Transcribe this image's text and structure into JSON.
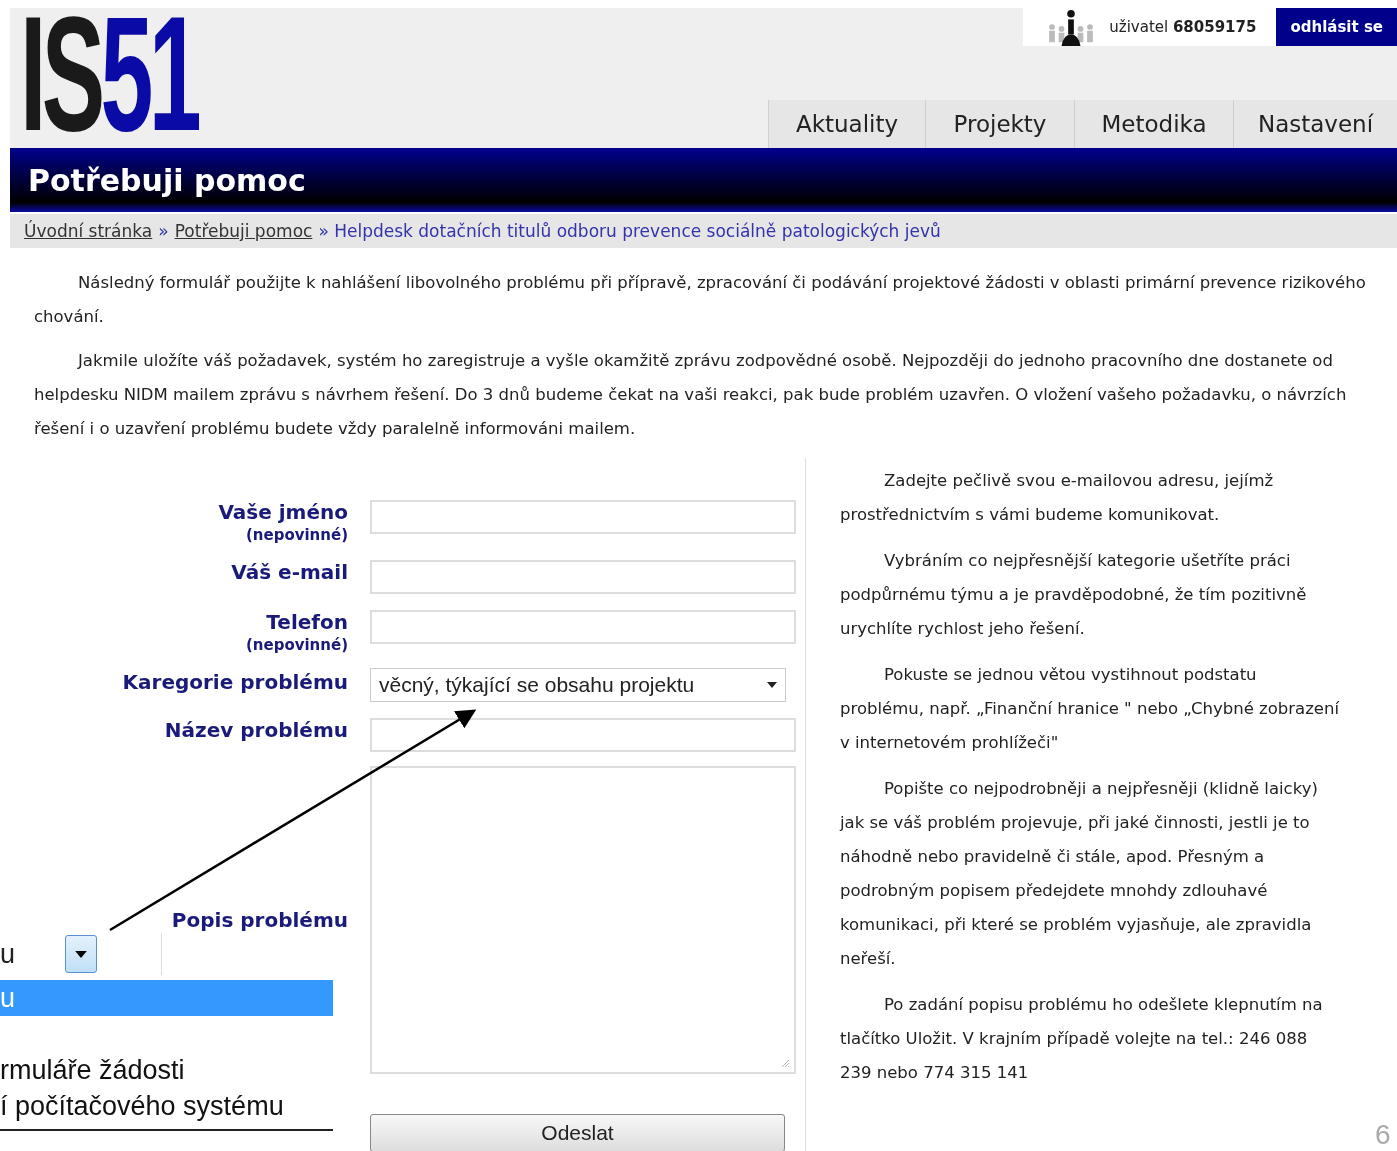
{
  "logo": {
    "part_1": "IS",
    "part_2": "51"
  },
  "user": {
    "label": "uživatel",
    "id": "68059175",
    "logout": "odhlásit se"
  },
  "tabs": [
    {
      "label": "Aktuality",
      "selected": false
    },
    {
      "label": "Projekty",
      "selected": false
    },
    {
      "label": "Metodika",
      "selected": false
    },
    {
      "label": "Nastavení",
      "selected": false
    }
  ],
  "page_title": "Potřebuji pomoc",
  "breadcrumb": [
    {
      "label": "Úvodní stránka",
      "link": true
    },
    {
      "label": "»",
      "link": false
    },
    {
      "label": "Potřebuji pomoc",
      "link": true
    },
    {
      "label": "» Helpdesk dotačních titulů odboru prevence sociálně patologických jevů",
      "link": false
    }
  ],
  "intro": [
    "Následný formulář použijte k nahlášení libovolného problému při přípravě, zpracování či podávání projektové žádosti v oblasti primární prevence rizikového chování.",
    "Jakmile uložíte váš požadavek, systém ho zaregistruje a vyšle okamžitě zprávu zodpovědné osobě. Nejpozději do jednoho pracovního dne dostanete od helpdesku NIDM mailem zprávu s návrhem řešení. Do 3 dnů budeme čekat na vaši reakci, pak bude problém uzavřen. O vložení vašeho požadavku, o návrzích řešení i o uzavření problému budete vždy paralelně informováni mailem."
  ],
  "form": {
    "fields": [
      {
        "kind": "text",
        "label": "Vaše jméno",
        "note": "(nepovinné)"
      },
      {
        "kind": "text",
        "label": "Váš e-mail"
      },
      {
        "kind": "text",
        "label": "Telefon",
        "note": "(nepovinné)"
      },
      {
        "kind": "select",
        "label": "Karegorie problému",
        "value": "věcný, týkající se obsahu projektu"
      },
      {
        "kind": "text",
        "label": "Název problému"
      },
      {
        "kind": "textarea",
        "label": "Popis problému"
      }
    ],
    "submit": "Odeslat"
  },
  "help": [
    "Zadejte pečlivě svou e-mailovou adresu, jejímž prostřednictvím s vámi budeme komunikovat.",
    "Vybráním co nejpřesnější kategorie ušetříte práci podpůrnému týmu a je pravděpodobné, že tím pozitivně urychlíte rychlost jeho řešení.",
    "Pokuste se jednou větou vystihnout podstatu problému, např. „Finanční hranice \" nebo „Chybné zobrazení v internetovém prohlížeči\"",
    "Popište co nejpodrobněji a nejpřesněji (klidně laicky) jak se váš problém projevuje, při jaké činnosti, jestli je to náhodně nebo pravidelně či stále, apod. Přesným a podrobným popisem předejdete mnohdy zdlouhavé komunikaci, při které se problém vyjasňuje, ale zpravidla neřeší.",
    "Po zadání popisu problému ho odešlete klepnutím na tlačítko Uložit. V krajním případě volejte na tel.: 246 088 239 nebo 774 315 141"
  ],
  "inset": {
    "combo_value": "u",
    "options": [
      {
        "label": "u",
        "selected": true
      },
      {
        "label": "rmuláře žádosti",
        "selected": false
      },
      {
        "label": "í počítačového systému",
        "selected": false
      }
    ]
  },
  "page_number": "6"
}
